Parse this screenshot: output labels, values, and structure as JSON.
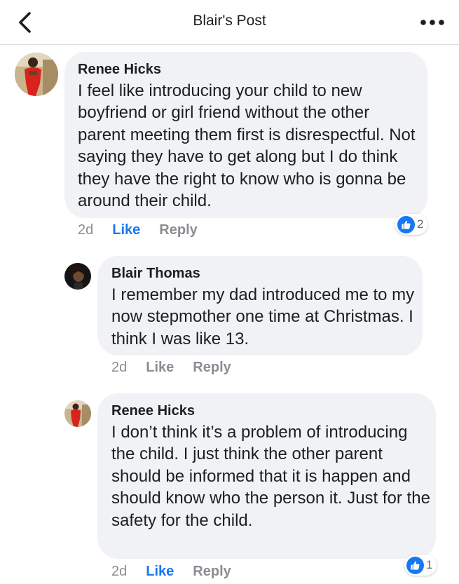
{
  "header": {
    "title": "Blair's Post",
    "back_icon": "chevron-left-icon",
    "more_icon": "more-horizontal-icon"
  },
  "colors": {
    "accent": "#1877f2",
    "bubble": "#f0f2f5",
    "meta_text": "#8a8d91"
  },
  "comments": [
    {
      "author": "Renee Hicks",
      "text": "I feel like introducing your child to new boyfriend or girl friend without the other parent meeting them first is disrespectful. Not saying they have to get along but I do think they have the right to know who is gonna be around their child.",
      "time": "2d",
      "like_label": "Like",
      "reply_label": "Reply",
      "liked": true,
      "reaction_count": "2"
    },
    {
      "author": "Blair Thomas",
      "text": "I remember my dad introduced me to my now stepmother one time at Christmas. I think I was like 13.",
      "time": "2d",
      "like_label": "Like",
      "reply_label": "Reply",
      "liked": false
    },
    {
      "author": "Renee Hicks",
      "text": "I don’t think it’s a problem of introducing the child. I just think the other parent should be informed that it is happen and should know who the person it. Just for the safety for the child.",
      "time": "2d",
      "like_label": "Like",
      "reply_label": "Reply",
      "liked": true,
      "reaction_count": "1"
    }
  ]
}
